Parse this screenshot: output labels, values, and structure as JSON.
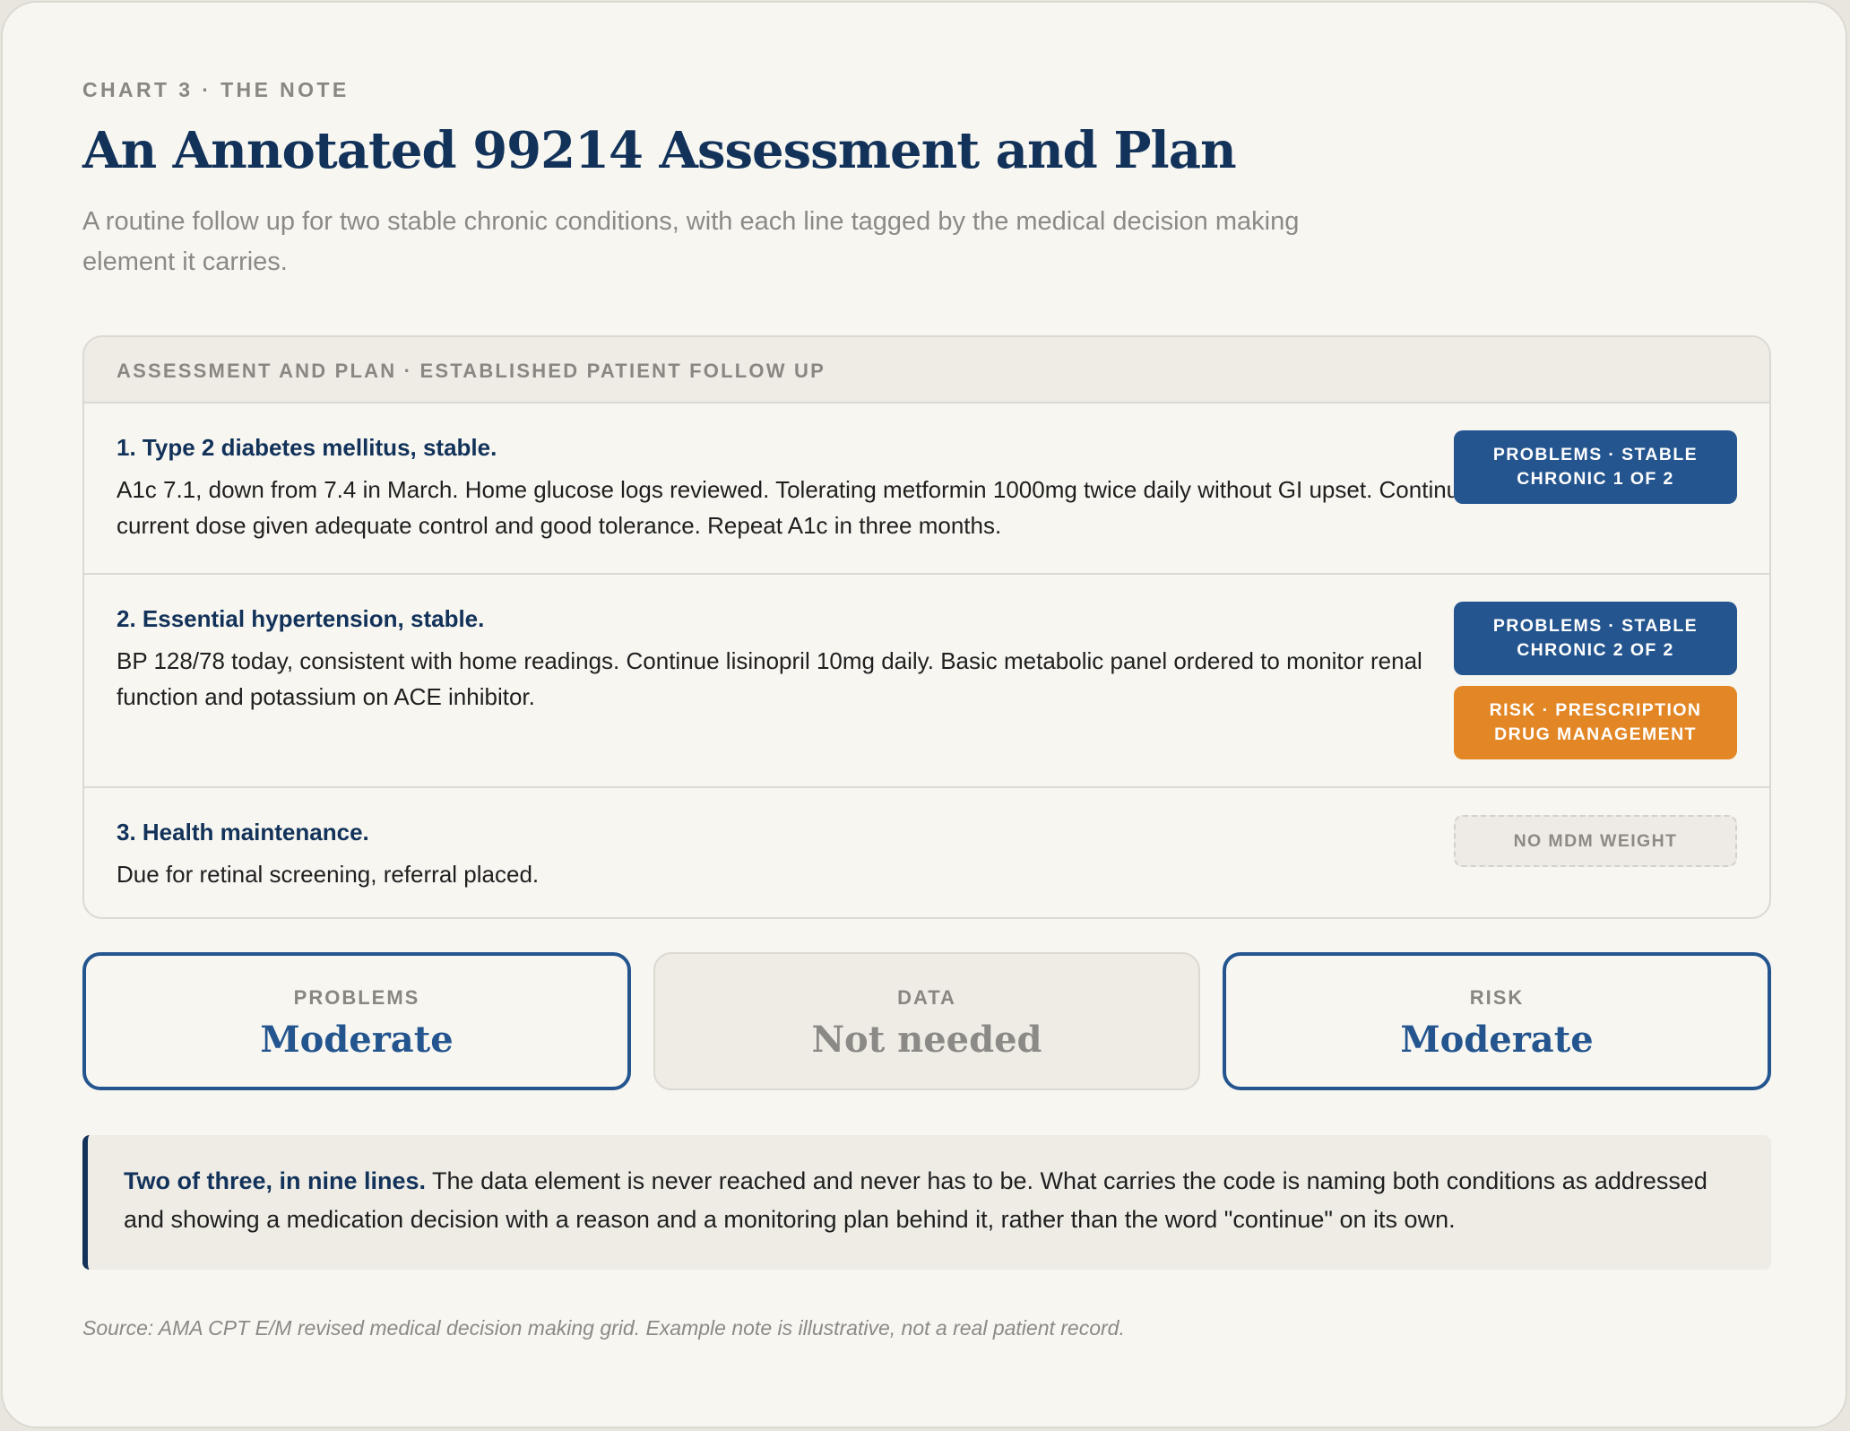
{
  "header": {
    "eyebrow": "CHART 3 · THE NOTE",
    "title": "An Annotated 99214 Assessment and Plan",
    "subtitle": "A routine follow up for two stable chronic conditions, with each line tagged by the medical decision making element it carries."
  },
  "note": {
    "heading": "ASSESSMENT AND PLAN · ESTABLISHED PATIENT FOLLOW UP",
    "items": [
      {
        "title": "1. Type 2 diabetes mellitus, stable.",
        "body": "A1c 7.1, down from 7.4 in March. Home glucose logs reviewed. Tolerating metformin 1000mg twice daily without GI upset. Continue current dose given adequate control and good tolerance. Repeat A1c in three months.",
        "tags": [
          {
            "text": "PROBLEMS · STABLE CHRONIC 1 OF 2",
            "color": "#24558f"
          }
        ]
      },
      {
        "title": "2. Essential hypertension, stable.",
        "body": "BP 128/78 today, consistent with home readings. Continue lisinopril 10mg daily. Basic metabolic panel ordered to monitor renal function and potassium on ACE inhibitor.",
        "tags": [
          {
            "text": "PROBLEMS · STABLE CHRONIC 2 OF 2",
            "color": "#24558f"
          },
          {
            "text": "RISK · PRESCRIPTION DRUG MANAGEMENT",
            "color": "#e38726"
          }
        ]
      },
      {
        "title": "3. Health maintenance.",
        "body": "Due for retinal screening, referral placed.",
        "tags": [
          {
            "text": "NO MDM WEIGHT",
            "color": "#eeebe6"
          }
        ]
      }
    ]
  },
  "summary": [
    {
      "label": "PROBLEMS",
      "value": "Moderate"
    },
    {
      "label": "DATA",
      "value": "Not needed"
    },
    {
      "label": "RISK",
      "value": "Moderate"
    }
  ],
  "callout": {
    "lead": "Two of three, in nine lines.",
    "text": " The data element is never reached and never has to be. What carries the code is naming both conditions as addressed and showing a medication decision with a reason and a monitoring plan behind it, rather than the word \"continue\" on its own."
  },
  "source": "Source: AMA CPT E/M revised medical decision making grid. Example note is illustrative, not a real patient record.",
  "colors": {
    "navy": "#12325a",
    "blue": "#24558f",
    "orange": "#e38726",
    "muted": "#8c8a86",
    "background": "#f7f6f1"
  }
}
